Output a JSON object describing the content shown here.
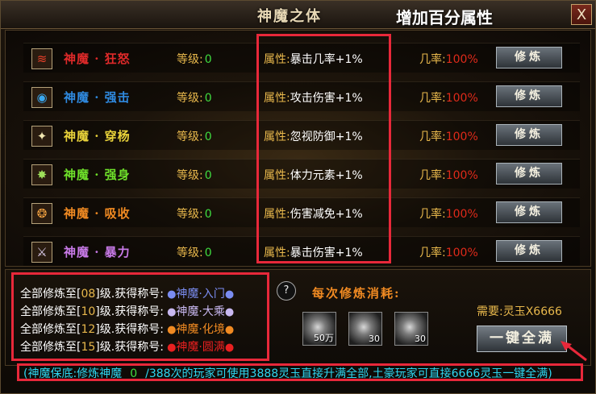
{
  "window": {
    "title": "神魔之体",
    "close_label": "X"
  },
  "annotation": {
    "title": "增加百分属性"
  },
  "rows": [
    {
      "name": "神魔 · 狂怒",
      "name_color": "#e02a2a",
      "icon": "fire-claw-icon",
      "icon_glyph": "≋",
      "icon_color": "#e8402a",
      "level_label": "等级:",
      "level": "0",
      "attr_label": "属性:",
      "attr_value": "暴击几率+1%",
      "rate_label": "几率:",
      "rate": "100%",
      "button": "修炼"
    },
    {
      "name": "神魔 · 强击",
      "name_color": "#2f8ae0",
      "icon": "swirl-icon",
      "icon_glyph": "◉",
      "icon_color": "#3aa8f0",
      "level_label": "等级:",
      "level": "0",
      "attr_label": "属性:",
      "attr_value": "攻击伤害+1%",
      "rate_label": "几率:",
      "rate": "100%",
      "button": "修炼"
    },
    {
      "name": "神魔 · 穿杨",
      "name_color": "#e8d23a",
      "icon": "figure-icon",
      "icon_glyph": "✦",
      "icon_color": "#f0e6b0",
      "level_label": "等级:",
      "level": "0",
      "attr_label": "属性:",
      "attr_value": "忽视防御+1%",
      "rate_label": "几率:",
      "rate": "100%",
      "button": "修炼"
    },
    {
      "name": "神魔 · 强身",
      "name_color": "#6ee02a",
      "icon": "sparkle-icon",
      "icon_glyph": "✸",
      "icon_color": "#9ee05a",
      "level_label": "等级:",
      "level": "0",
      "attr_label": "属性:",
      "attr_value": "体力元素+1%",
      "rate_label": "几率:",
      "rate": "100%",
      "button": "修炼"
    },
    {
      "name": "神魔 · 吸收",
      "name_color": "#f08a22",
      "icon": "vortex-icon",
      "icon_glyph": "❂",
      "icon_color": "#f0a040",
      "level_label": "等级:",
      "level": "0",
      "attr_label": "属性:",
      "attr_value": "伤害减免+1%",
      "rate_label": "几率:",
      "rate": "100%",
      "button": "修炼"
    },
    {
      "name": "神魔 · 暴力",
      "name_color": "#c87ae8",
      "icon": "sword-icon",
      "icon_glyph": "⚔",
      "icon_color": "#e0d0f0",
      "level_label": "等级:",
      "level": "0",
      "attr_label": "属性:",
      "attr_value": "暴击伤害+1%",
      "rate_label": "几率:",
      "rate": "100%",
      "button": "修炼"
    }
  ],
  "titles": [
    {
      "prefix": "全部修炼至[",
      "level": "08",
      "suffix": "]级.获得称号:",
      "title": "神魔·入门",
      "color": "#7a8cf0"
    },
    {
      "prefix": "全部修炼至[",
      "level": "10",
      "suffix": "]级.获得称号:",
      "title": "神魔·大乘",
      "color": "#c8b8f0"
    },
    {
      "prefix": "全部修炼至[",
      "level": "12",
      "suffix": "]级.获得称号:",
      "title": "神魔·化境",
      "color": "#f08a22"
    },
    {
      "prefix": "全部修炼至[",
      "level": "15",
      "suffix": "]级.获得称号:",
      "title": "神魔·圆满",
      "color": "#e82020"
    }
  ],
  "cost": {
    "help_icon": "?",
    "label": "每次修炼消耗:",
    "items": [
      {
        "name": "silver-ingot-icon",
        "count": "50万"
      },
      {
        "name": "ore-icon",
        "count": "30"
      },
      {
        "name": "orb-icon",
        "count": "30"
      }
    ],
    "need": "需要:灵玉X6666",
    "max_button": "一键全满"
  },
  "footer": {
    "part1": "(神魔保底:修炼神魔",
    "count": "0",
    "part2": "/388次的玩家可使用3888灵玉直接升满全部,土豪玩家可直接6666灵玉一键全满)"
  },
  "colors": {
    "annotation": "#e8283a",
    "gold": "#e8b84c",
    "green": "#3fdc3f",
    "red": "#e02a1a",
    "cyan": "#2ed6f0"
  }
}
